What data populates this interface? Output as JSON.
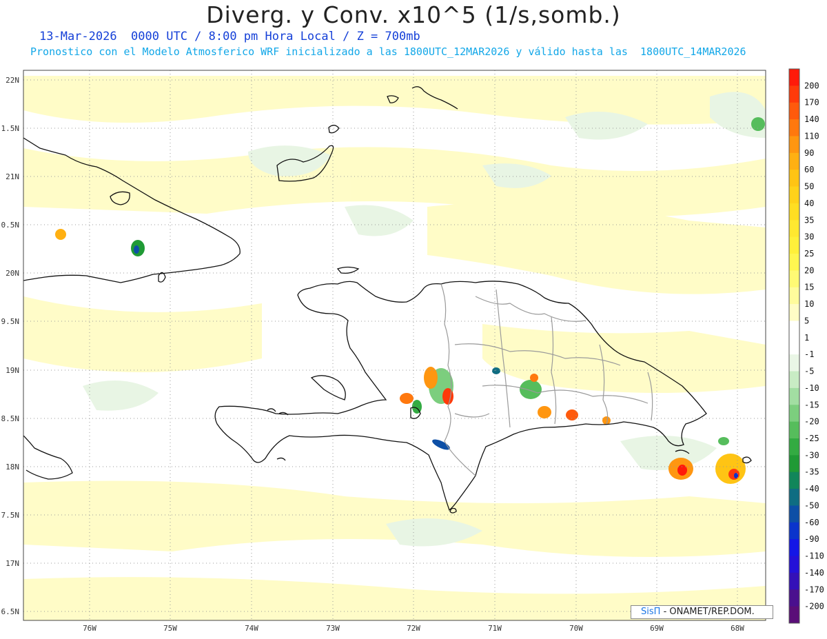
{
  "header": {
    "title": "Diverg. y Conv. x10^5 (1/s,somb.)",
    "subtitle_time": "13-Mar-2026  0000 UTC / 8:00 pm Hora Local / Z = 700mb",
    "subtitle_model": "Pronostico con el Modelo Atmosferico WRF inicializado a las 1800UTC_12MAR2026 y válido hasta las  1800UTC_14MAR2026"
  },
  "map": {
    "lat_labels": [
      "22N",
      "1.5N",
      "21N",
      "0.5N",
      "20N",
      "9.5N",
      "19N",
      "8.5N",
      "18N",
      "7.5N",
      "17N",
      "6.5N"
    ],
    "lon_labels": [
      "76W",
      "75W",
      "74W",
      "73W",
      "72W",
      "71W",
      "70W",
      "69W",
      "68W"
    ]
  },
  "colorbar": {
    "labels": [
      "200",
      "170",
      "140",
      "110",
      "90",
      "60",
      "50",
      "40",
      "35",
      "30",
      "25",
      "20",
      "15",
      "10",
      "5",
      "1",
      "-1",
      "-5",
      "-10",
      "-15",
      "-20",
      "-25",
      "-30",
      "-35",
      "-40",
      "-50",
      "-60",
      "-90",
      "-110",
      "-140",
      "-170",
      "-200"
    ],
    "colors": [
      "#ff1a0a",
      "#ff3a0a",
      "#ff5a0c",
      "#ff780e",
      "#ff9610",
      "#ffb012",
      "#ffc414",
      "#ffd21a",
      "#ffde22",
      "#ffe830",
      "#fff03a",
      "#fff650",
      "#fffa74",
      "#fffc9c",
      "#fffdc6",
      "#ffffff",
      "#ffffff",
      "#eaf6e6",
      "#c8ecc4",
      "#a2dea2",
      "#7cce7e",
      "#56bd5c",
      "#33ab42",
      "#1f9a35",
      "#11865a",
      "#0f6d82",
      "#0d4fa6",
      "#0b34cc",
      "#1416e6",
      "#2410d8",
      "#3410b8",
      "#4a108e",
      "#5a0e78"
    ]
  },
  "credit": {
    "logo": "SisΠ",
    "text": "- ONAMET/REP.DOM."
  }
}
